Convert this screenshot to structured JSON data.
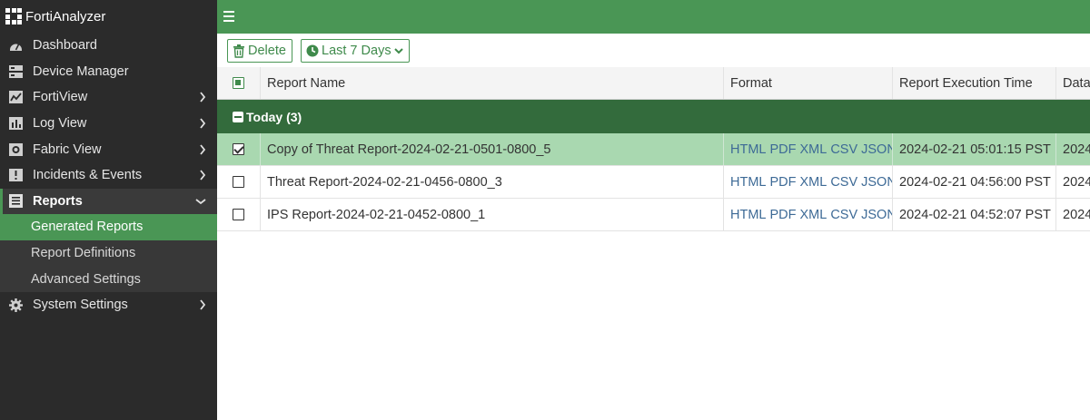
{
  "app": {
    "title": "FortiAnalyzer"
  },
  "sidebar": {
    "items": [
      {
        "label": "Dashboard",
        "icon": "dashboard-icon",
        "chevron": false
      },
      {
        "label": "Device Manager",
        "icon": "device-manager-icon",
        "chevron": false
      },
      {
        "label": "FortiView",
        "icon": "fortiview-icon",
        "chevron": true
      },
      {
        "label": "Log View",
        "icon": "log-view-icon",
        "chevron": true
      },
      {
        "label": "Fabric View",
        "icon": "fabric-view-icon",
        "chevron": true
      },
      {
        "label": "Incidents & Events",
        "icon": "incidents-icon",
        "chevron": true
      },
      {
        "label": "Reports",
        "icon": "reports-icon",
        "chevron": "down"
      },
      {
        "label": "System Settings",
        "icon": "gear-icon",
        "chevron": true
      }
    ],
    "reports_sub": [
      {
        "label": "Generated Reports",
        "selected": true
      },
      {
        "label": "Report Definitions",
        "selected": false
      },
      {
        "label": "Advanced Settings",
        "selected": false
      }
    ]
  },
  "toolbar": {
    "delete_label": "Delete",
    "range_label": "Last 7 Days"
  },
  "table": {
    "columns": [
      "Report Name",
      "Format",
      "Report Execution Time",
      "Data"
    ],
    "group": {
      "label": "Today (3)"
    },
    "rows": [
      {
        "name": "Copy of Threat Report-2024-02-21-0501-0800_5",
        "formats": [
          "HTML",
          "PDF",
          "XML",
          "CSV",
          "JSON"
        ],
        "time": "2024-02-21 05:01:15 PST",
        "data": "2024",
        "checked": true
      },
      {
        "name": "Threat Report-2024-02-21-0456-0800_3",
        "formats": [
          "HTML",
          "PDF",
          "XML",
          "CSV",
          "JSON"
        ],
        "time": "2024-02-21 04:56:00 PST",
        "data": "2024",
        "checked": false
      },
      {
        "name": "IPS Report-2024-02-21-0452-0800_1",
        "formats": [
          "HTML",
          "PDF",
          "XML",
          "CSV",
          "JSON"
        ],
        "time": "2024-02-21 04:52:07 PST",
        "data": "2024",
        "checked": false
      }
    ]
  },
  "colors": {
    "brand_green": "#4a9655",
    "group_green": "#336b3c",
    "selected_row": "#a9d8b0",
    "sidebar_bg": "#2b2b2b",
    "link_blue": "#3d6a96"
  }
}
